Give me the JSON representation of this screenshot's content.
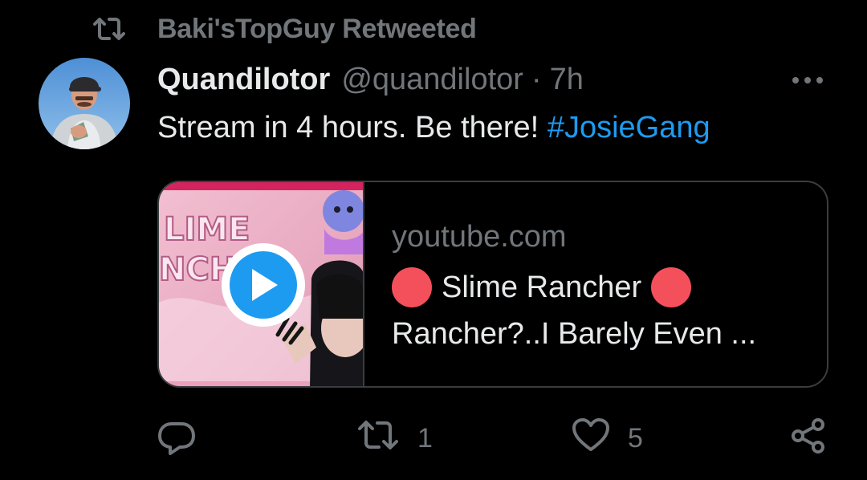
{
  "retweet": {
    "label": "Baki'sTopGuy Retweeted",
    "icon": "retweet-icon"
  },
  "tweet": {
    "author_name": "Quandilotor",
    "author_handle": "@quandilotor",
    "separator": "·",
    "time": "7h",
    "text_prefix": "Stream in 4 hours. Be there! ",
    "hashtag": "#JosieGang"
  },
  "card": {
    "domain": "youtube.com",
    "title": "Slime Rancher",
    "description": "Rancher?..I Barely Even ...",
    "thumbnail_text": "SLIME RANCHER",
    "live_color": "#f4505c"
  },
  "actions": {
    "replies": "",
    "retweets": "1",
    "likes": "5"
  },
  "colors": {
    "accent": "#1d9bf0",
    "muted": "#71767b",
    "text": "#e7e9ea",
    "background": "#000000"
  }
}
